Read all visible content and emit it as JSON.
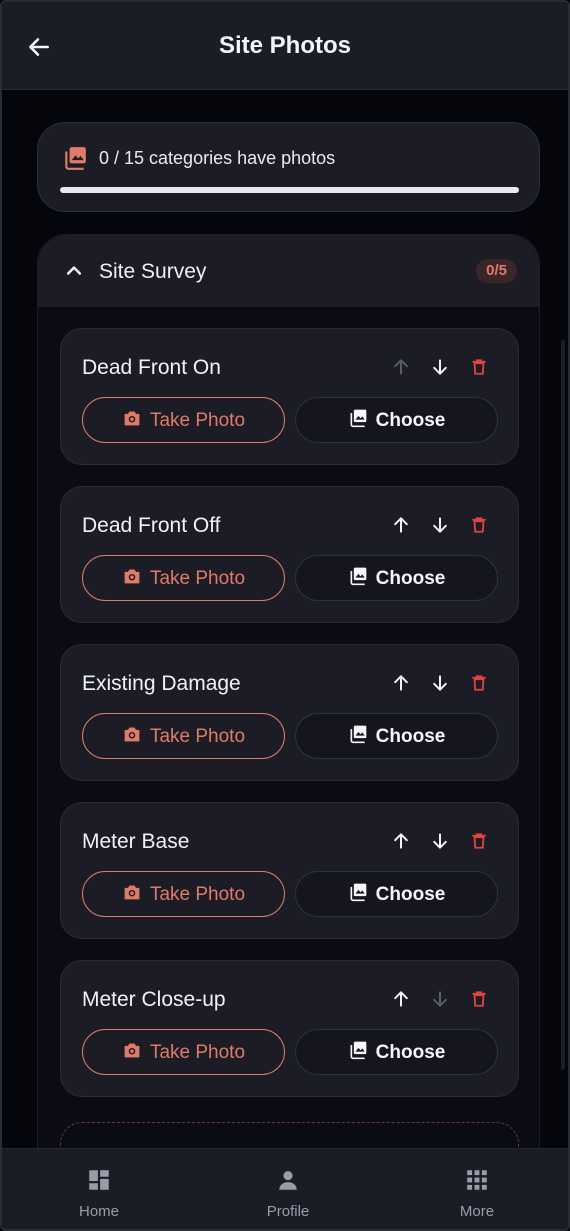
{
  "header": {
    "title": "Site Photos"
  },
  "summary": {
    "text": "0 / 15 categories have photos",
    "completed": 0,
    "total": 15
  },
  "section": {
    "title": "Site Survey",
    "badge": "0/5",
    "items": [
      {
        "title": "Dead Front On",
        "up_enabled": false,
        "down_enabled": true
      },
      {
        "title": "Dead Front Off",
        "up_enabled": true,
        "down_enabled": true
      },
      {
        "title": "Existing Damage",
        "up_enabled": true,
        "down_enabled": true
      },
      {
        "title": "Meter Base",
        "up_enabled": true,
        "down_enabled": true
      },
      {
        "title": "Meter Close-up",
        "up_enabled": true,
        "down_enabled": false
      }
    ]
  },
  "labels": {
    "take_photo": "Take Photo",
    "choose": "Choose"
  },
  "nav": {
    "home": "Home",
    "profile": "Profile",
    "more": "More"
  },
  "colors": {
    "accent": "#e07b68",
    "danger": "#e0453f",
    "surface": "#1b1c25",
    "background": "#05060c"
  }
}
